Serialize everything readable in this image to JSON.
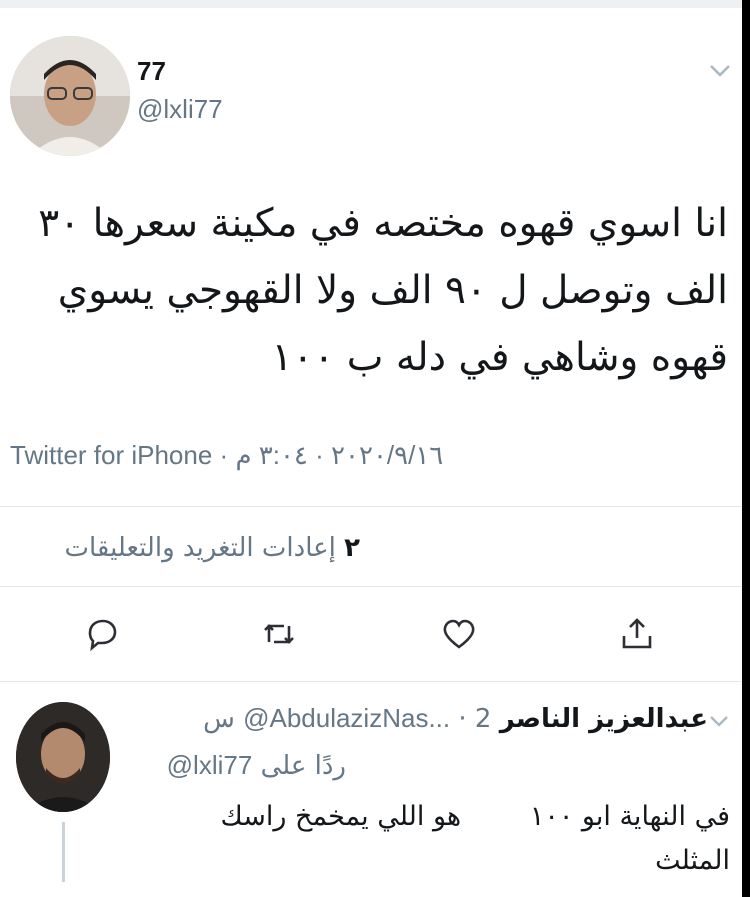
{
  "tweet": {
    "display_name": "77",
    "handle": "@lxli77",
    "text_lines": [
      "انا اسوي قهوه مختصه في مكينة سعرها ٣٠",
      "الف وتوصل ل ٩٠ الف ولا القهوجي يسوي",
      "قهوه وشاهي في دله ب ١٠٠"
    ],
    "source": "Twitter for iPhone",
    "date": "٢٠٢٠/٩/١٦",
    "time": "٣:٠٤ م",
    "separator": "·",
    "retweets_count": "٢",
    "retweets_label": "إعادات التغريد والتعليقات"
  },
  "actions": {
    "reply_icon": "reply-icon",
    "retweet_icon": "retweet-icon",
    "like_icon": "heart-icon",
    "share_icon": "share-icon"
  },
  "reply": {
    "display_name": "عبدالعزيز الناصر",
    "handle": "@AbdulazizNas...",
    "time": "2 س",
    "separator": "·",
    "replying_to_prefix": "ردًا على",
    "replying_to_handle": "@lxli77",
    "text_line1": "في النهاية ابو ١٠٠        هو اللي يمخمخ راسك",
    "text_line2": "المثلث"
  },
  "colors": {
    "text": "#14171a",
    "secondary": "#657786",
    "divider": "#e1e8ed"
  }
}
